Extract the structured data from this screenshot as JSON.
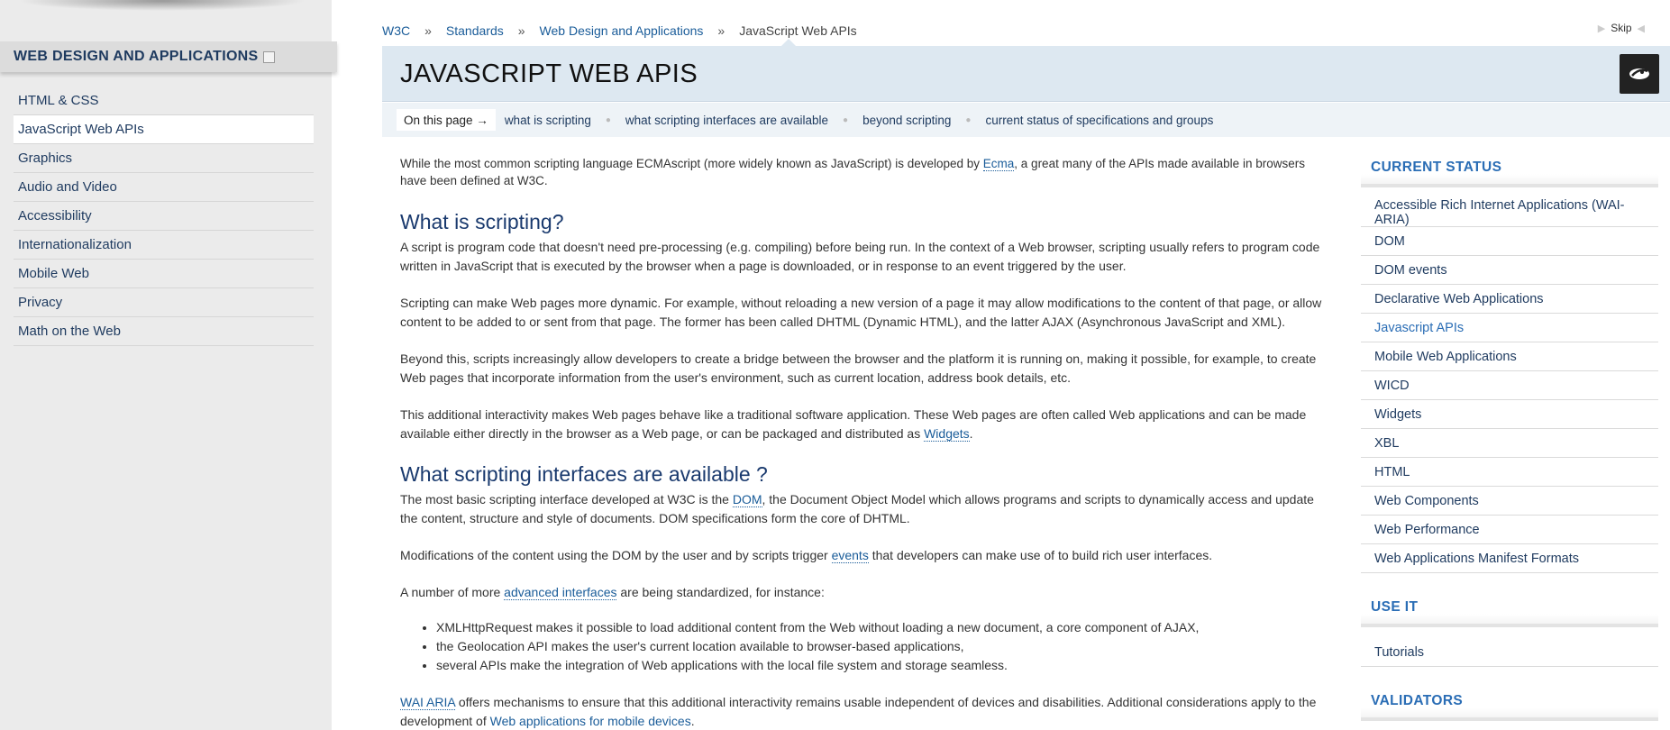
{
  "sidebar": {
    "title": "WEB DESIGN AND APPLICATIONS",
    "items": [
      {
        "label": "HTML & CSS"
      },
      {
        "label": "JavaScript Web APIs"
      },
      {
        "label": "Graphics"
      },
      {
        "label": "Audio and Video"
      },
      {
        "label": "Accessibility"
      },
      {
        "label": "Internationalization"
      },
      {
        "label": "Mobile Web"
      },
      {
        "label": "Privacy"
      },
      {
        "label": "Math on the Web"
      }
    ],
    "active_index": 1
  },
  "breadcrumb": {
    "items": [
      "W3C",
      "Standards",
      "Web Design and Applications"
    ],
    "separator": "»",
    "current": "JavaScript Web APIs"
  },
  "skip_label": "Skip",
  "header": {
    "title": "JAVASCRIPT WEB APIS"
  },
  "onpage": {
    "label": "On this page →",
    "links": [
      "what is scripting",
      "what scripting interfaces are available",
      "beyond scripting",
      "current status of specifications and groups"
    ]
  },
  "content": {
    "intro": {
      "before": "While the most common scripting language ECMAscript (more widely known as JavaScript) is developed by ",
      "link": "Ecma",
      "after": ", a great many of the APIs made available in browsers have been defined at W3C."
    },
    "h1": "What is scripting?",
    "p1": "A script is program code that doesn't need pre-processing (e.g. compiling) before being run. In the context of a Web browser, scripting usually refers to program code written in JavaScript that is executed by the browser when a page is downloaded, or in response to an event triggered by the user.",
    "p2": "Scripting can make Web pages more dynamic. For example, without reloading a new version of a page it may allow modifications to the content of that page, or allow content to be added to or sent from that page. The former has been called DHTML (Dynamic HTML), and the latter AJAX (Asynchronous JavaScript and XML).",
    "p3": "Beyond this, scripts increasingly allow developers to create a bridge between the browser and the platform it is running on, making it possible, for example, to create Web pages that incorporate information from the user's environment, such as current location, address book details, etc.",
    "p4": {
      "before": "This additional interactivity makes Web pages behave like a traditional software application. These Web pages are often called Web applications and can be made available either directly in the browser as a Web page, or can be packaged and distributed as ",
      "link": "Widgets",
      "after": "."
    },
    "h2": "What scripting interfaces are available ?",
    "p5": {
      "before": "The most basic scripting interface developed at W3C is the ",
      "link": "DOM",
      "after": ", the Document Object Model which allows programs and scripts to dynamically access and update the content, structure and style of documents. DOM specifications form the core of DHTML."
    },
    "p6": {
      "before": "Modifications of the content using the DOM by the user and by scripts trigger ",
      "link": "events",
      "after": " that developers can make use of to build rich user interfaces."
    },
    "p7": {
      "before": "A number of more ",
      "link": "advanced interfaces",
      "after": " are being standardized, for instance:"
    },
    "bullets": [
      "XMLHttpRequest makes it possible to load additional content from the Web without loading a new document, a core component of AJAX,",
      "the Geolocation API makes the user's current location available to browser-based applications,",
      "several APIs make the integration of Web applications with the local file system and storage seamless."
    ],
    "p8": {
      "link1": "WAI ARIA",
      "middle": " offers mechanisms to ensure that this additional interactivity remains usable independent of devices and disabilities. Additional considerations apply to the development of ",
      "link2": "Web applications for mobile devices",
      "after": "."
    }
  },
  "aside": {
    "current_status": {
      "title": "CURRENT STATUS",
      "items": [
        "Accessible Rich Internet Applications (WAI-ARIA)",
        "DOM",
        "DOM events",
        "Declarative Web Applications",
        "Javascript APIs",
        "Mobile Web Applications",
        "WICD",
        "Widgets",
        "XBL",
        "HTML",
        "Web Components",
        "Web Performance",
        "Web Applications Manifest Formats"
      ],
      "active_index": 4
    },
    "use_it": {
      "title": "USE IT",
      "items": [
        "Tutorials"
      ]
    },
    "validators": {
      "title": "VALIDATORS"
    }
  },
  "colors": {
    "link": "#1a5c99",
    "heading": "#1a3a6e",
    "aside_heading": "#2a6db5",
    "header_bg": "#dde8f1"
  }
}
